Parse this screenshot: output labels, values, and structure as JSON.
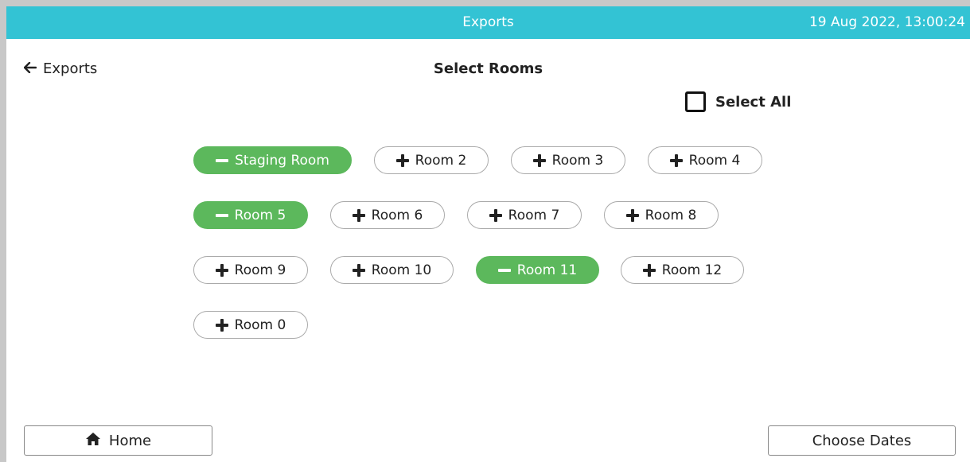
{
  "topbar": {
    "title": "Exports",
    "datetime": "19 Aug 2022, 13:00:24"
  },
  "back": {
    "label": "Exports"
  },
  "heading": "Select Rooms",
  "select_all": {
    "label": "Select All",
    "checked": false
  },
  "rooms": [
    {
      "label": "Staging Room",
      "selected": true
    },
    {
      "label": "Room 2",
      "selected": false
    },
    {
      "label": "Room 3",
      "selected": false
    },
    {
      "label": "Room 4",
      "selected": false
    },
    {
      "label": "Room 5",
      "selected": true
    },
    {
      "label": "Room 6",
      "selected": false
    },
    {
      "label": "Room 7",
      "selected": false
    },
    {
      "label": "Room 8",
      "selected": false
    },
    {
      "label": "Room 9",
      "selected": false
    },
    {
      "label": "Room 10",
      "selected": false
    },
    {
      "label": "Room 11",
      "selected": true
    },
    {
      "label": "Room 12",
      "selected": false
    },
    {
      "label": "Room 0",
      "selected": false
    }
  ],
  "footer": {
    "home_label": "Home",
    "choose_dates_label": "Choose Dates"
  },
  "colors": {
    "topbar": "#33c3d4",
    "selected": "#5cb85c"
  }
}
